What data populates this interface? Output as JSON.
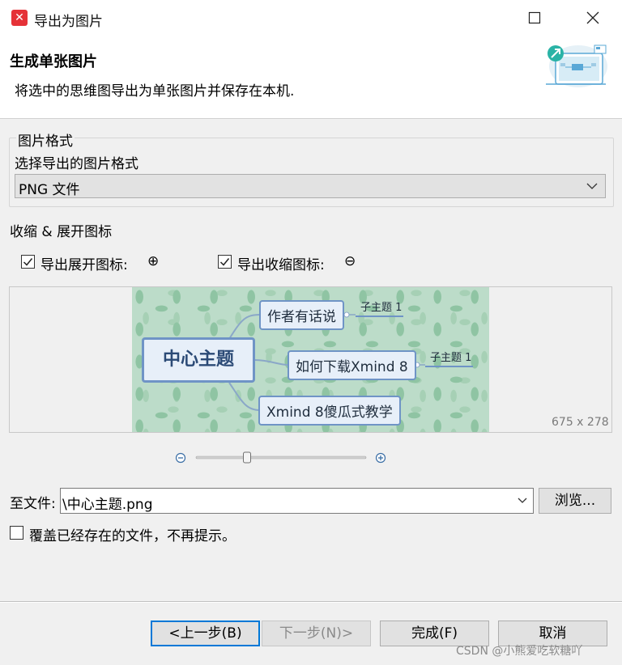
{
  "window": {
    "title": "导出为图片",
    "app_icon_glyph": "✕",
    "app_icon_name": "xmind-logo-icon",
    "minimize_glyph": "—",
    "maximize_glyph": "☐",
    "close_glyph": "✕"
  },
  "header": {
    "title": "生成单张图片",
    "description": "将选中的思维图导出为单张图片并保存在本机."
  },
  "format_group": {
    "legend": "图片格式",
    "label": "选择导出的图片格式",
    "selected": "PNG 文件"
  },
  "icons_section": {
    "label": "收缩 & 展开图标",
    "export_expand": {
      "label": "导出展开图标:",
      "checked": true,
      "icon": "⊕"
    },
    "export_collapse": {
      "label": "导出收缩图标:",
      "checked": true,
      "icon": "⊖"
    }
  },
  "preview": {
    "center_topic": "中心主题",
    "topic_1": "作者有话说",
    "topic_2": "如何下载Xmind 8",
    "topic_3": "Xmind 8傻瓜式教学",
    "subtopic_1": "子主题 1",
    "subtopic_2": "子主题 1",
    "dimensions": "675 x 278",
    "zoom_level": 0.3
  },
  "zoom": {
    "minus_icon": "zoom-out-icon",
    "plus_icon": "zoom-in-icon"
  },
  "file": {
    "label": "至文件:",
    "value": "\\中心主题.png",
    "browse_label": "浏览..."
  },
  "overwrite": {
    "label": "覆盖已经存在的文件，不再提示。",
    "checked": false
  },
  "buttons": {
    "back": "<上一步(B)",
    "next": "下一步(N)>",
    "finish": "完成(F)",
    "cancel": "取消"
  },
  "watermark": "CSDN @小熊爱吃软糖吖",
  "colors": {
    "accent": "#0078d7",
    "node_border": "#6f94c6",
    "preview_bg": "#bcdcc9",
    "logo_red": "#e53238"
  }
}
